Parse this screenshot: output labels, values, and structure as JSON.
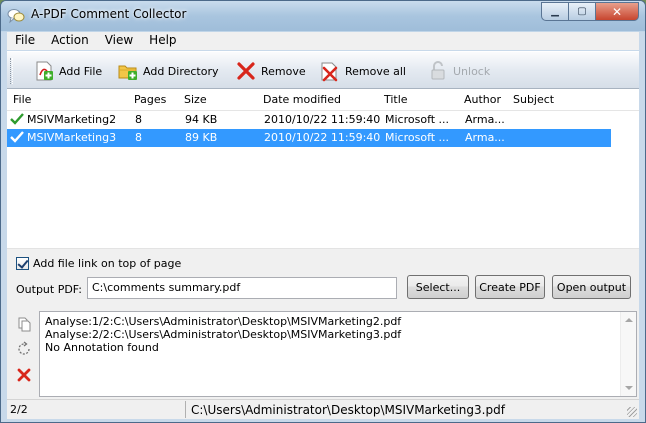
{
  "window": {
    "title": "A-PDF Comment Collector",
    "controls": {
      "minimize": "▁",
      "maximize": "▢",
      "close": "✕"
    }
  },
  "menu": [
    "File",
    "Action",
    "View",
    "Help"
  ],
  "toolbar": {
    "add_file": "Add File",
    "add_directory": "Add Directory",
    "remove": "Remove",
    "remove_all": "Remove all",
    "unlock": "Unlock"
  },
  "file_list": {
    "columns": [
      "File",
      "Pages",
      "Size",
      "Date modified",
      "Title",
      "Author",
      "Subject"
    ],
    "rows": [
      {
        "file": "MSIVMarketing2",
        "pages": "8",
        "size": "94 KB",
        "date": "2010/10/22 11:59:40",
        "title": "Microsoft ...",
        "author": "Arma...",
        "subject": "",
        "selected": false
      },
      {
        "file": "MSIVMarketing3",
        "pages": "8",
        "size": "89 KB",
        "date": "2010/10/22 11:59:40",
        "title": "Microsoft ...",
        "author": "Arma...",
        "subject": "",
        "selected": true
      }
    ]
  },
  "options": {
    "add_file_link_label": "Add file link on top of page",
    "add_file_link_checked": true,
    "output_label": "Output PDF:",
    "output_value": "C:\\comments summary.pdf"
  },
  "buttons": {
    "select": "Select...",
    "create_pdf": "Create PDF",
    "open_output": "Open output"
  },
  "log": [
    "Analyse:1/2:C:\\Users\\Administrator\\Desktop\\MSIVMarketing2.pdf",
    "Analyse:2/2:C:\\Users\\Administrator\\Desktop\\MSIVMarketing3.pdf",
    "No Annotation found"
  ],
  "status": {
    "count": "2/2",
    "path": "C:\\Users\\Administrator\\Desktop\\MSIVMarketing3.pdf"
  },
  "colors": {
    "selection": "#3399ff",
    "titlebar": "#a9c5df"
  },
  "icons": {
    "app": "comment-collector-icon",
    "add_file": "add-file-icon",
    "add_directory": "add-directory-icon",
    "remove": "remove-icon",
    "remove_all": "remove-all-icon",
    "unlock": "unlock-icon",
    "row_status": "checkmark-icon",
    "copy": "copy-icon",
    "refresh": "refresh-icon",
    "clear": "clear-icon"
  }
}
